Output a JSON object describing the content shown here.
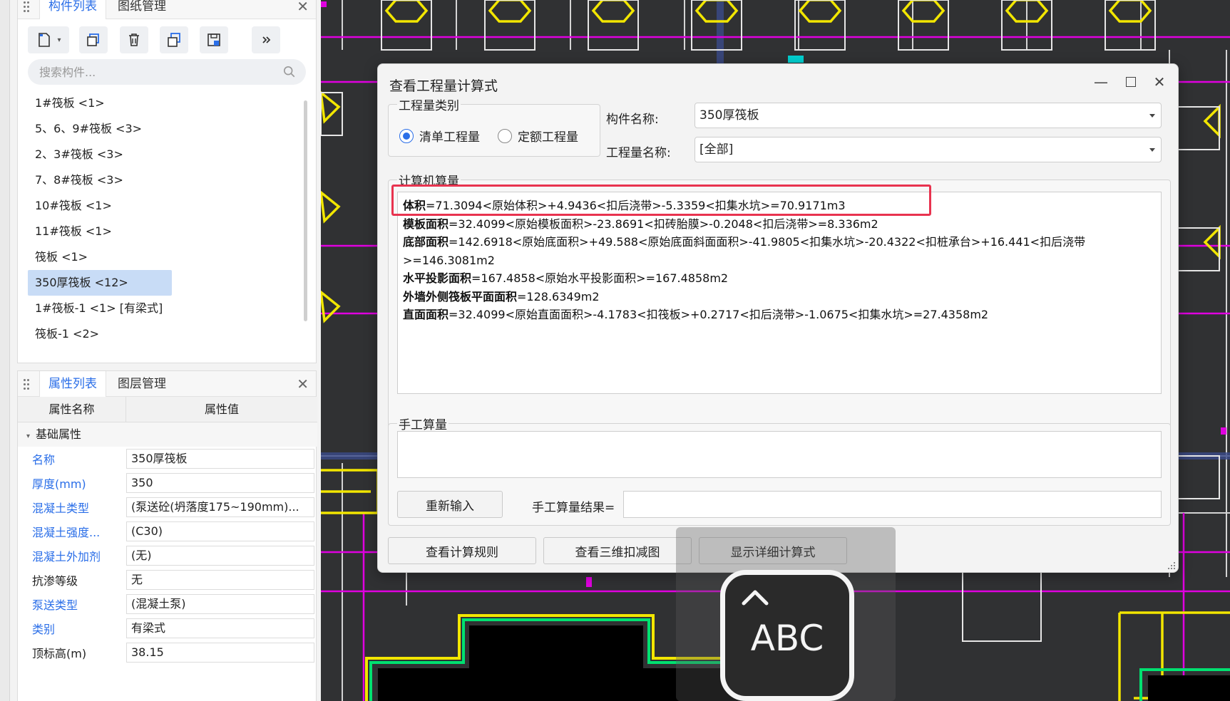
{
  "component_panel": {
    "tabs": [
      "构件列表",
      "图纸管理"
    ],
    "search_placeholder": "搜索构件...",
    "items": [
      "1#筏板 <1>",
      "5、6、9#筏板 <3>",
      "2、3#筏板 <3>",
      "7、8#筏板 <3>",
      "10#筏板 <1>",
      "11#筏板 <1>",
      "筏板 <1>",
      "350厚筏板 <12>",
      "1#筏板-1 <1> [有梁式]",
      "筏板-1 <2>"
    ],
    "selected_index": 7
  },
  "property_panel": {
    "tabs": [
      "属性列表",
      "图层管理"
    ],
    "columns": [
      "属性名称",
      "属性值"
    ],
    "group": "基础属性",
    "rows": [
      {
        "name": "名称",
        "value": "350厚筏板",
        "blue": true
      },
      {
        "name": "厚度(mm)",
        "value": "350",
        "blue": true
      },
      {
        "name": "混凝土类型",
        "value": "(泵送砼(坍落度175~190mm)...",
        "blue": true
      },
      {
        "name": "混凝土强度...",
        "value": "(C30)",
        "blue": true
      },
      {
        "name": "混凝土外加剂",
        "value": "(无)",
        "blue": true
      },
      {
        "name": "抗渗等级",
        "value": "无",
        "blue": false
      },
      {
        "name": "泵送类型",
        "value": "(混凝土泵)",
        "blue": true
      },
      {
        "name": "类别",
        "value": "有梁式",
        "blue": true
      },
      {
        "name": "顶标高(m)",
        "value": "38.15",
        "blue": false
      }
    ]
  },
  "dialog": {
    "title": "查看工程量计算式",
    "category_legend": "工程量类别",
    "radio_options": [
      "清单工程量",
      "定额工程量"
    ],
    "radio_selected": 0,
    "component_name_label": "构件名称:",
    "component_name_value": "350厚筏板",
    "quantity_name_label": "工程量名称:",
    "quantity_name_value": "[全部]",
    "computer_legend": "计算机算量",
    "formulas": [
      {
        "label": "体积",
        "text": "=71.3094<原始体积>+4.9436<扣后浇带>-5.3359<扣集水坑>=70.9171m3"
      },
      {
        "label": "模板面积",
        "text": "=32.4099<原始模板面积>-23.8691<扣砖胎膜>-0.2048<扣后浇带>=8.336m2"
      },
      {
        "label": "底部面积",
        "text": "=142.6918<原始底面积>+49.588<原始底面斜面面积>-41.9805<扣集水坑>-20.4322<扣桩承台>+16.441<扣后浇带>=146.3081m2"
      },
      {
        "label": "水平投影面积",
        "text": "=167.4858<原始水平投影面积>=167.4858m2"
      },
      {
        "label": "外墙外侧筏板平面面积",
        "text": "=128.6349m2"
      },
      {
        "label": "直面面积",
        "text": "=32.4099<原始直面面积>-4.1783<扣筏板>+0.2717<扣后浇带>-1.0675<扣集水坑>=27.4358m2"
      }
    ],
    "manual_legend": "手工算量",
    "reinput_label": "重新输入",
    "manual_result_label": "手工算量结果=",
    "buttons": [
      "查看计算规则",
      "查看三维扣减图",
      "显示详细计算式"
    ]
  },
  "keyboard_overlay": {
    "label": "ABC"
  },
  "colors": {
    "accent": "#2a6ee8",
    "highlight": "#e8334f",
    "cad_yellow": "#f2e600",
    "cad_magenta": "#e000e0"
  }
}
